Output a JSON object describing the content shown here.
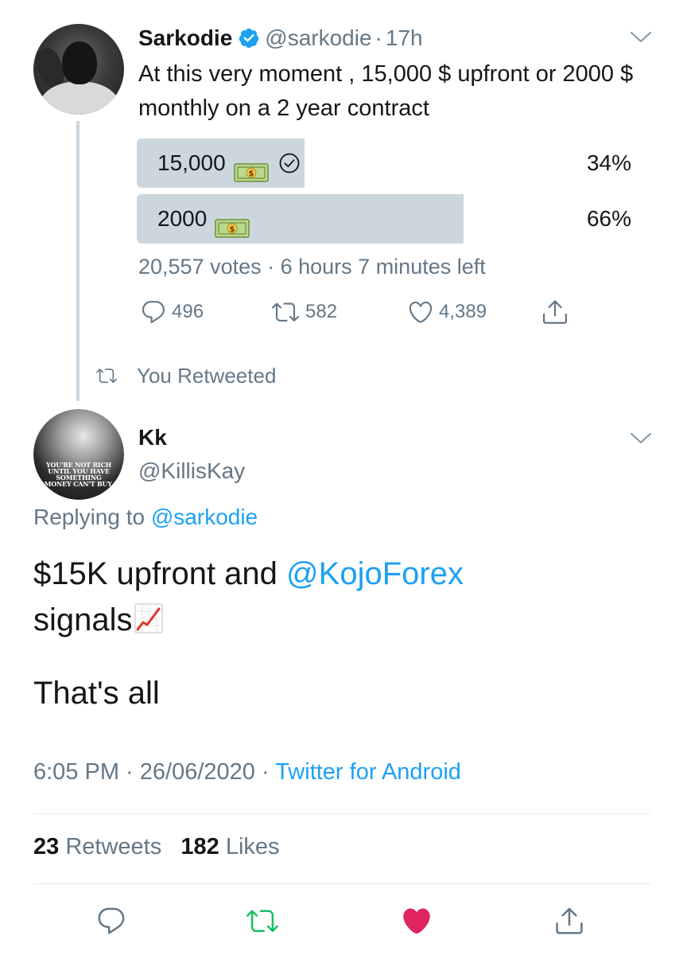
{
  "poll_tweet": {
    "author_name": "Sarkodie",
    "handle": "@sarkodie",
    "dot": "·",
    "time": "17h",
    "text": "At this very moment , 15,000 $ upfront or 2000 $ monthly on a 2 year contract",
    "poll": {
      "options": [
        {
          "label": "15,000",
          "emoji": "money-bill-emoji",
          "percent_text": "34%",
          "fill_fraction": 0.34,
          "winner_mark": "check-icon"
        },
        {
          "label": "2000",
          "emoji": "money-bill-emoji",
          "percent_text": "66%",
          "fill_fraction": 0.66
        }
      ],
      "meta": "20,557 votes · 6 hours 7 minutes left"
    },
    "actions": {
      "replies": "496",
      "retweets": "582",
      "likes": "4,389"
    },
    "retweeted_label": "You Retweeted"
  },
  "reply_tweet": {
    "author_name": "Kk",
    "handle": "@KillisKay",
    "avatar_quote": [
      "YOU'RE NOT RICH",
      "UNTIL YOU HAVE SOMETHING",
      "MONEY CAN'T BUY."
    ],
    "replying_prefix": "Replying to",
    "replying_to": "@sarkodie",
    "text_part1": "$15K upfront and",
    "mention": "@KojoForex",
    "text_part2": "signals",
    "text_emoji": "chart-increasing-emoji",
    "text_line2": "That's all",
    "timestamp": "6:05 PM · 26/06/2020 ·",
    "source": "Twitter for Android",
    "stats": {
      "retweets_count": "23",
      "retweets_label": "Retweets",
      "likes_count": "182",
      "likes_label": "Likes"
    }
  },
  "colors": {
    "text": "#14171a",
    "secondary": "#657786",
    "link": "#1da1f2",
    "poll_bar": "#ccd6dd",
    "retweet_green": "#17bf63",
    "like_red": "#e0245e"
  },
  "bottom_actions": [
    "reply-icon",
    "retweet-icon",
    "like-icon",
    "share-icon"
  ]
}
